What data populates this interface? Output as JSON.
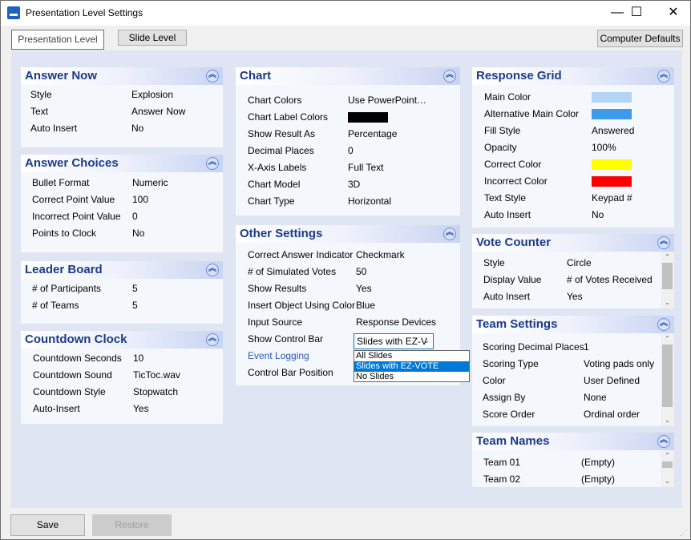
{
  "window": {
    "title": "Presentation Level Settings",
    "minimize": "—",
    "maximize": "☐",
    "close": "✕"
  },
  "tabs": {
    "presentation": "Presentation Level",
    "slide": "Slide Level"
  },
  "computer_defaults": "Computer Defaults",
  "collapse_glyph": "︽",
  "answer_now": {
    "title": "Answer Now",
    "rows": [
      {
        "label": "Style",
        "value": "Explosion"
      },
      {
        "label": "Text",
        "value": "Answer Now"
      },
      {
        "label": "Auto Insert",
        "value": "No"
      }
    ]
  },
  "answer_choices": {
    "title": "Answer Choices",
    "rows": [
      {
        "label": "Bullet Format",
        "value": "Numeric"
      },
      {
        "label": "Correct Point Value",
        "value": "100"
      },
      {
        "label": "Incorrect Point Value",
        "value": "0"
      },
      {
        "label": "Points to Clock",
        "value": "No"
      }
    ]
  },
  "leader_board": {
    "title": "Leader Board",
    "rows": [
      {
        "label": "# of Participants",
        "value": "5"
      },
      {
        "label": "# of Teams",
        "value": "5"
      }
    ]
  },
  "countdown_clock": {
    "title": "Countdown Clock",
    "rows": [
      {
        "label": "Countdown Seconds",
        "value": "10"
      },
      {
        "label": "Countdown Sound",
        "value": "TicToc.wav"
      },
      {
        "label": "Countdown Style",
        "value": "Stopwatch"
      },
      {
        "label": "Auto-Insert",
        "value": "Yes"
      }
    ]
  },
  "chart": {
    "title": "Chart",
    "rows": [
      {
        "label": "Chart Colors",
        "value": "Use  PowerPoint…"
      },
      {
        "label": "Chart Label Colors",
        "value": ""
      },
      {
        "label": "Show Result As",
        "value": "Percentage"
      },
      {
        "label": "Decimal Places",
        "value": "0"
      },
      {
        "label": "X-Axis Labels",
        "value": "Full Text"
      },
      {
        "label": "Chart Model",
        "value": "3D"
      },
      {
        "label": "Chart Type",
        "value": "Horizontal"
      }
    ],
    "label_color": "#000000"
  },
  "other_settings": {
    "title": "Other Settings",
    "rows": [
      {
        "label": "Correct Answer Indicator",
        "value": "Checkmark"
      },
      {
        "label": "# of Simulated Votes",
        "value": "50"
      },
      {
        "label": "Show Results",
        "value": "Yes"
      },
      {
        "label": "Insert Object Using Color",
        "value": "Blue"
      },
      {
        "label": "Input Source",
        "value": "Response Devices"
      },
      {
        "label": "Show Control Bar",
        "value": ""
      },
      {
        "label": "Event Logging",
        "value": ""
      },
      {
        "label": "Control Bar Position",
        "value": ""
      }
    ],
    "control_bar_combo": "Slides with EZ-V",
    "dropdown_options": [
      "All Slides",
      "Slides with EZ-VOTE Objects",
      "No Slides"
    ],
    "selected_option": "Slides with EZ-VOTE Objects"
  },
  "response_grid": {
    "title": "Response Grid",
    "rows": [
      {
        "label": "Main Color",
        "value": ""
      },
      {
        "label": "Alternative Main Color",
        "value": ""
      },
      {
        "label": "Fill Style",
        "value": "Answered"
      },
      {
        "label": "Opacity",
        "value": "100%"
      },
      {
        "label": "Correct Color",
        "value": ""
      },
      {
        "label": "Incorrect Color",
        "value": ""
      },
      {
        "label": "Text Style",
        "value": "Keypad #"
      },
      {
        "label": "Auto Insert",
        "value": "No"
      }
    ],
    "colors": {
      "main": "#b3d4f5",
      "alternative": "#3d9be9",
      "correct": "#ffff00",
      "incorrect": "#ff0000"
    }
  },
  "vote_counter": {
    "title": "Vote Counter",
    "rows": [
      {
        "label": "Style",
        "value": "Circle"
      },
      {
        "label": "Display Value",
        "value": "# of Votes Received"
      },
      {
        "label": "Auto Insert",
        "value": "Yes"
      }
    ]
  },
  "team_settings": {
    "title": "Team Settings",
    "rows": [
      {
        "label": "Scoring Decimal Places",
        "value": "1"
      },
      {
        "label": "Scoring Type",
        "value": "Voting pads only"
      },
      {
        "label": "Color",
        "value": "User Defined"
      },
      {
        "label": "Assign By",
        "value": "None"
      },
      {
        "label": "Score Order",
        "value": "Ordinal order"
      }
    ]
  },
  "team_names": {
    "title": "Team Names",
    "rows": [
      {
        "label": "Team 01",
        "value": "(Empty)"
      },
      {
        "label": "Team 02",
        "value": "(Empty)"
      }
    ]
  },
  "footer": {
    "save": "Save",
    "restore": "Restore"
  }
}
